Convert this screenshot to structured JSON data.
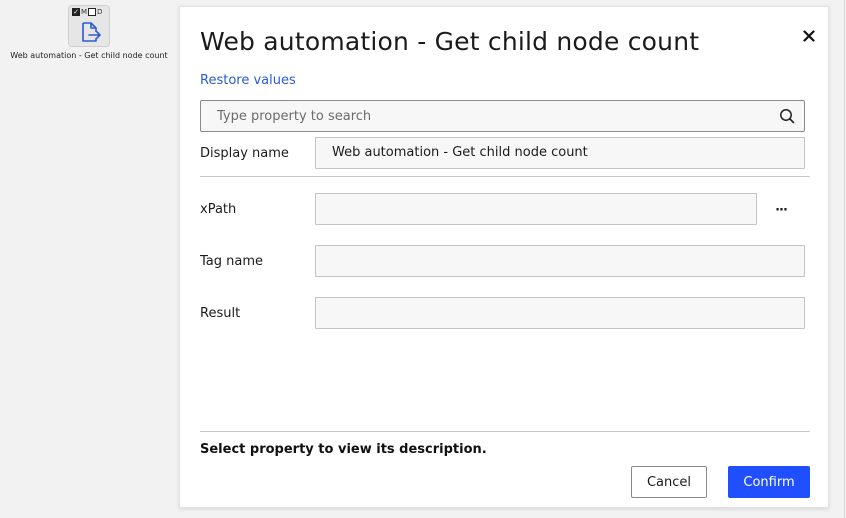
{
  "canvas_node": {
    "flag_m": "M",
    "flag_d": "D",
    "flag_m_checked": true,
    "flag_d_checked": false,
    "icon": "file-export-icon",
    "label": "Web automation - Get child node count"
  },
  "dialog": {
    "title": "Web automation - Get child node count",
    "close_icon": "close-icon",
    "restore_label": "Restore values",
    "search": {
      "placeholder": "Type property to search",
      "value": "",
      "icon": "search-icon"
    },
    "properties": [
      {
        "label": "Display name",
        "value": "Web automation - Get child node count"
      },
      {
        "label": "xPath",
        "value": "",
        "has_browse": true,
        "browse_label": "···"
      },
      {
        "label": "Tag name",
        "value": ""
      },
      {
        "label": "Result",
        "value": ""
      }
    ],
    "description": "Select property to view its description.",
    "cancel_label": "Cancel",
    "confirm_label": "Confirm"
  },
  "colors": {
    "accent": "#1f4fff",
    "link": "#2a5bd7"
  }
}
